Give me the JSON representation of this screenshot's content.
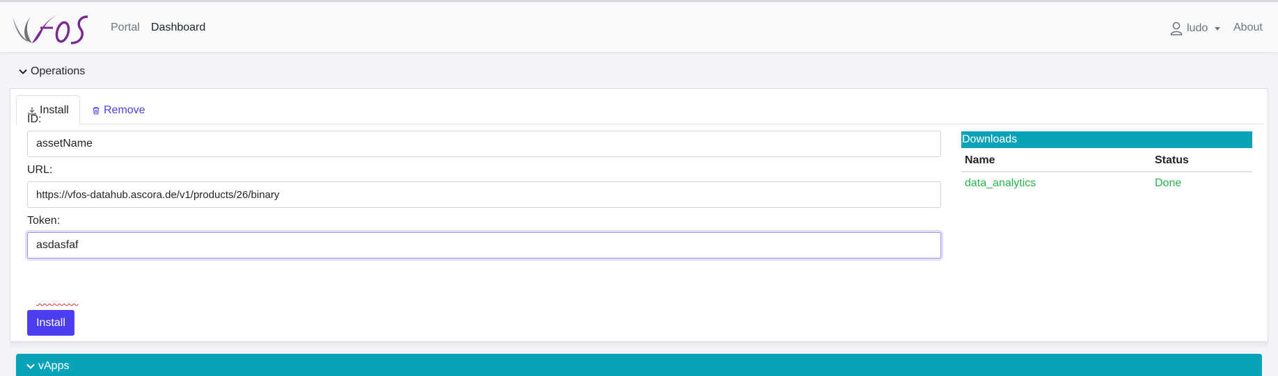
{
  "nav": {
    "logo_text": "vFOS",
    "links": [
      "Portal",
      "Dashboard"
    ],
    "user": "ludo",
    "about": "About"
  },
  "operations": {
    "title": "Operations",
    "tabs": {
      "install": "Install",
      "remove": "Remove"
    },
    "form": {
      "id_label": "ID:",
      "id_value": "assetName",
      "url_label": "URL:",
      "url_value": "https://vfos-datahub.ascora.de/v1/products/26/binary",
      "token_label": "Token:",
      "token_value": "asdasfaf",
      "install_button": "Install"
    },
    "downloads": {
      "title": "Downloads",
      "columns": [
        "Name",
        "Status"
      ],
      "rows": [
        {
          "name": "data_analytics",
          "status": "Done"
        }
      ]
    }
  },
  "vapps": {
    "title": "vApps"
  },
  "colors": {
    "accent_teal": "#0aa2b8",
    "primary_button": "#4a3ef0",
    "status_done": "#28b34a",
    "link_purple": "#4a3ee8"
  }
}
